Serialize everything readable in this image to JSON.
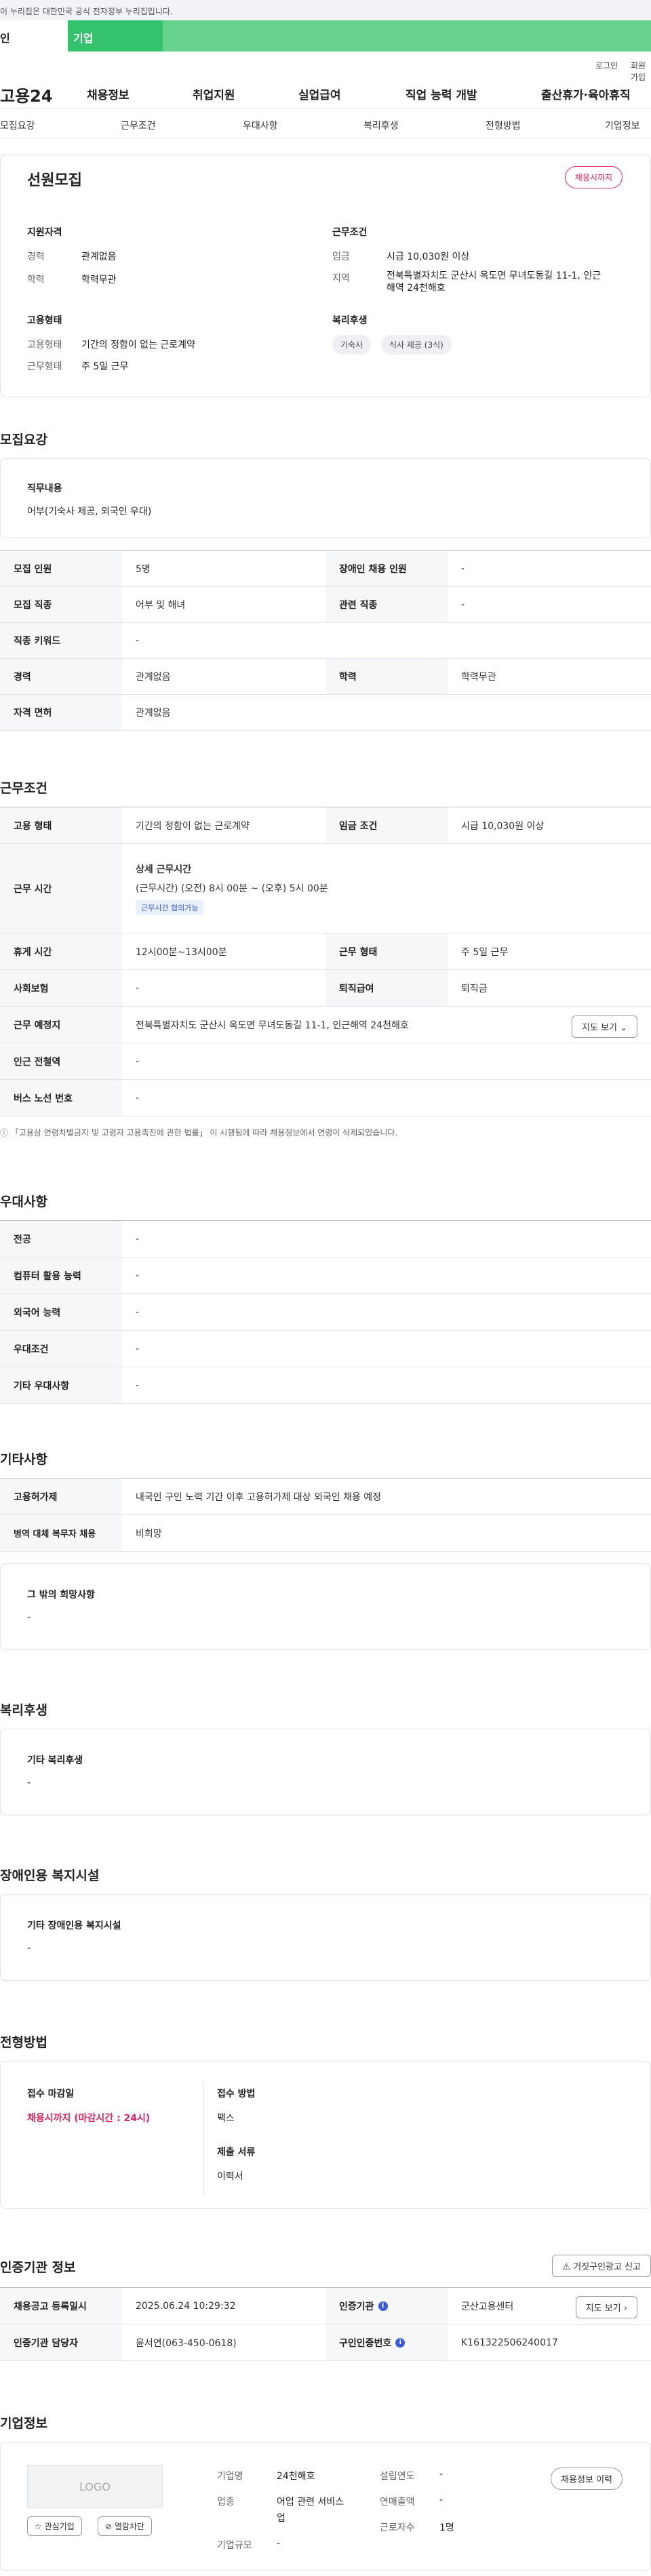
{
  "gov_banner": "이 누리집은 대한민국 공식 전자정부 누리집입니다.",
  "tabs": {
    "person": "인",
    "company": "기업"
  },
  "util": {
    "login": "로그인",
    "join": "회원가입"
  },
  "gnb": {
    "logo": "고용24",
    "menu": [
      "채용정보",
      "취업지원",
      "실업급여",
      "직업 능력 개발",
      "출산휴가·육아휴직"
    ]
  },
  "subnav": [
    "모집요강",
    "근무조건",
    "우대사항",
    "복리후생",
    "전형방법",
    "기업정보"
  ],
  "summary": {
    "title": "선원모집",
    "status_badge": "채용시까지",
    "qualification_title": "지원자격",
    "career_label": "경력",
    "career_value": "관계없음",
    "edu_label": "학력",
    "edu_value": "학력무관",
    "employment_title": "고용형태",
    "emp_type_label": "고용형태",
    "emp_type_value": "기간의 정함이 없는 근로계약",
    "work_type_label": "근무형태",
    "work_type_value": "주 5일 근무",
    "conditions_title": "근무조건",
    "wage_label": "임금",
    "wage_value": "시급 10,030원 이상",
    "region_label": "지역",
    "region_line1": "전북특별자치도 군산시 옥도면 무녀도동길 11-1, 인근",
    "region_line2": "해역 24천해호",
    "welfare_title": "복리후생",
    "welfare_chips": [
      "기숙사",
      "식사 제공 (3식)"
    ]
  },
  "recruit": {
    "title": "모집요강",
    "job_title": "직무내용",
    "job_text": "어부(기숙사 제공, 외국인 우대)",
    "rows": [
      {
        "k1": "모집 인원",
        "v1": "5명",
        "k2": "장애인 채용 인원",
        "v2": "-"
      },
      {
        "k1": "모집 직종",
        "v1": "어부 및 해녀",
        "k2": "관련 직종",
        "v2": "-"
      },
      {
        "k1": "직종 키워드",
        "v1": "-"
      },
      {
        "k1": "경력",
        "v1": "관계없음",
        "k2": "학력",
        "v2": "학력무관"
      },
      {
        "k1": "자격 면허",
        "v1": "관계없음"
      }
    ]
  },
  "conditions": {
    "title": "근무조건",
    "emp_type_k": "고용 형태",
    "emp_type_v": "기간의 정함이 없는 근로계약",
    "wage_k": "임금 조건",
    "wage_v": "시급 10,030원 이상",
    "hours_k": "근무 시간",
    "hours_title": "상세 근무시간",
    "hours_text": "(근무시간) (오전) 8시 00분 ~ (오후) 5시 00분",
    "hours_badge": "근무시간 협의가능",
    "rest_k": "휴게 시간",
    "rest_v": "12시00분~13시00분",
    "worktype_k": "근무 형태",
    "worktype_v": "주 5일 근무",
    "insurance_k": "사회보험",
    "insurance_v": "-",
    "retire_k": "퇴직급여",
    "retire_v": "퇴직금",
    "place_k": "근무 예정지",
    "place_v": "전북특별자치도 군산시 옥도면 무녀도동길 11-1, 인근해역 24천해호",
    "map_button": "지도 보기",
    "subway_k": "인근 전철역",
    "subway_v": "-",
    "bus_k": "버스 노선 번호",
    "bus_v": "-",
    "note": "「고용상 연령차별금지 및 고령자 고용촉진에 관한 법률」 이 시행됨에 따라 채용정보에서 연령이 삭제되었습니다."
  },
  "preference": {
    "title": "우대사항",
    "rows": [
      {
        "k": "전공",
        "v": "-"
      },
      {
        "k": "컴퓨터 활용 능력",
        "v": "-"
      },
      {
        "k": "외국어 능력",
        "v": "-"
      },
      {
        "k": "우대조건",
        "v": "-"
      },
      {
        "k": "기타 우대사항",
        "v": "-"
      }
    ]
  },
  "etc": {
    "title": "기타사항",
    "permit_k": "고용허가제",
    "permit_v": "내국인 구인 노력 기간 이후 고용허가제 대상 외국인 채용 예정",
    "military_k": "병역 대체 복무자 채용",
    "military_v": "비희망",
    "other_title": "그 밖의 희망사항",
    "other_v": "-"
  },
  "welfare": {
    "title": "복리후생",
    "sub": "기타 복리후생",
    "v": "-"
  },
  "disabled": {
    "title": "장애인용 복지시설",
    "sub": "기타 장애인용 복지시설",
    "v": "-"
  },
  "selection": {
    "title": "전형방법",
    "deadline_k": "접수 마감일",
    "deadline_v": "채용시까지 (마감시간 : 24시)",
    "method_k": "접수 방법",
    "method_v": "팩스",
    "docs_k": "제출 서류",
    "docs_v": "이력서"
  },
  "agency": {
    "title": "인증기관 정보",
    "report_button": "거짓구인광고 신고",
    "reg_k": "채용공고 등록일시",
    "reg_v": "2025.06.24 10:29:32",
    "agency_k": "인증기관",
    "agency_v": "군산고용센터",
    "map_button": "지도 보기",
    "manager_k": "인증기관 담당자",
    "manager_v": "윤서연(063-450-0618)",
    "num_k": "구인인증번호",
    "num_v": "K161322506240017"
  },
  "company": {
    "title": "기업정보",
    "logo_text": "LOGO",
    "interest_button": "관심기업",
    "block_button": "열람차단",
    "name_k": "기업명",
    "name_v": "24천해호",
    "industry_k": "업종",
    "industry_v1": "어업 관련 서비스",
    "industry_v2": "업",
    "size_k": "기업규모",
    "size_v": "-",
    "founded_k": "설립연도",
    "founded_v": "-",
    "sales_k": "연매출액",
    "sales_v": "-",
    "employees_k": "근로자수",
    "employees_v": "1명",
    "history_button": "채용정보 이력"
  }
}
